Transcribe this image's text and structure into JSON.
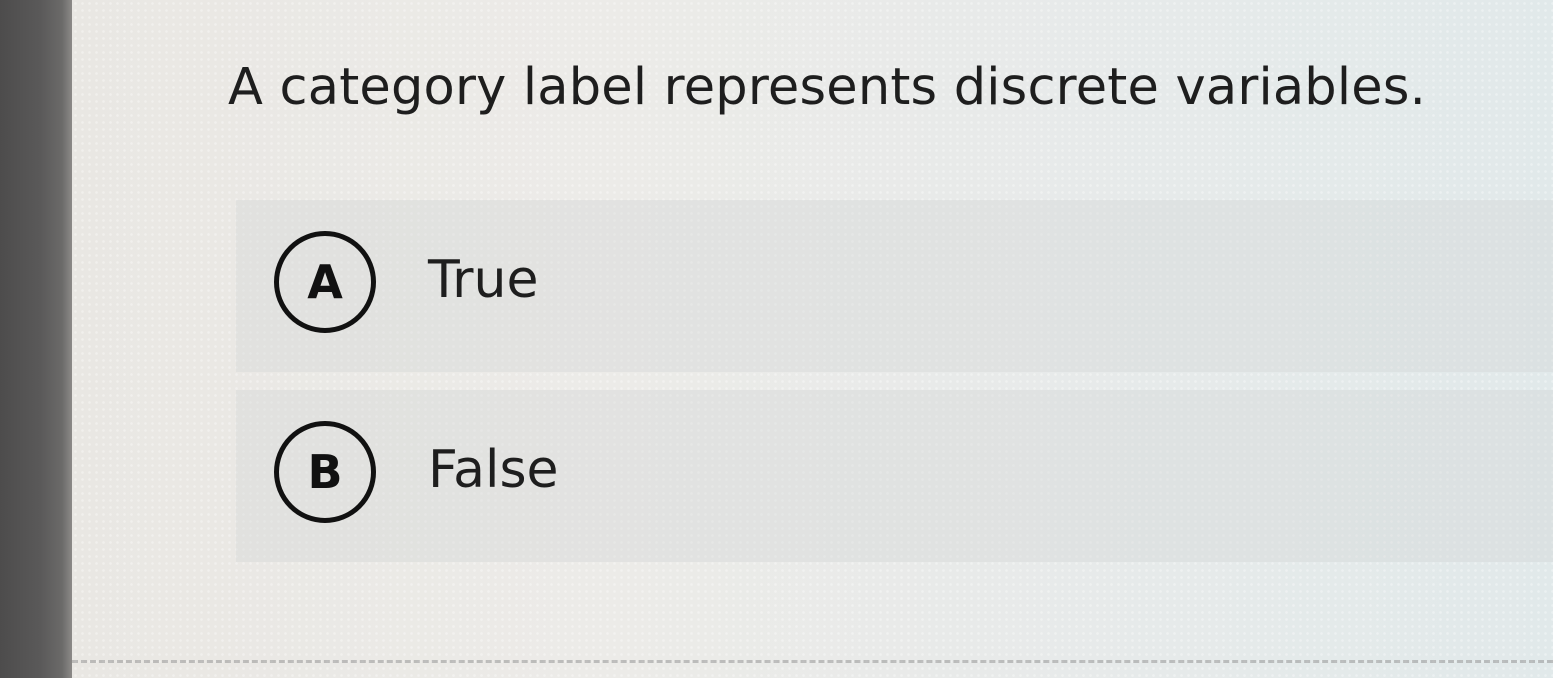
{
  "question": {
    "text": "A category label represents discrete variables."
  },
  "options": [
    {
      "letter": "A",
      "label": "True"
    },
    {
      "letter": "B",
      "label": "False"
    }
  ]
}
